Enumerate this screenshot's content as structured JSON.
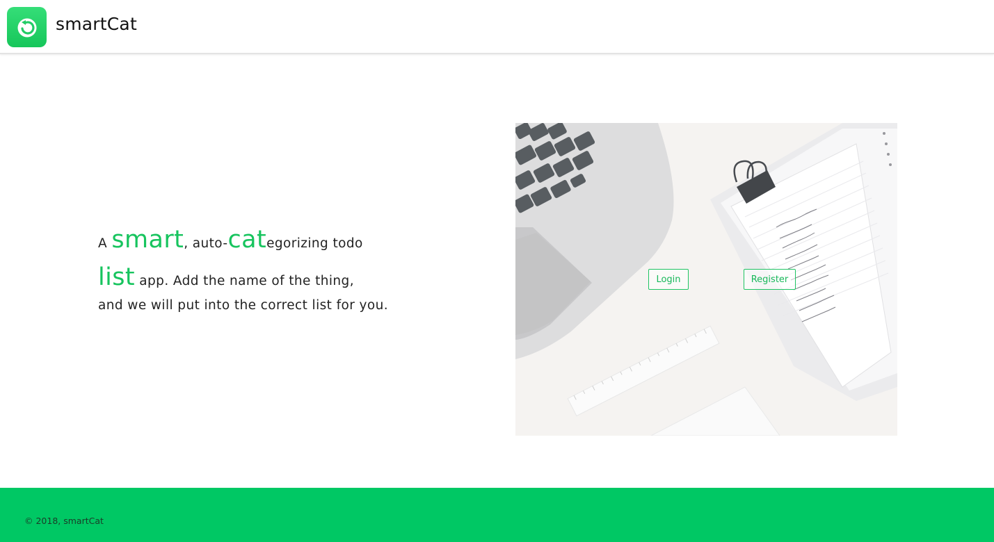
{
  "header": {
    "brand": "smartCat",
    "logo_icon": "refresh-arrow-icon"
  },
  "tagline": {
    "prefix": "A ",
    "smart": "smart",
    "mid1": ", auto-",
    "cat": "cat",
    "mid2": "egorizing todo",
    "list": "list",
    "mid3": " app. Add the name of the thing,",
    "rest": "and we will put into the correct list for you."
  },
  "hero": {
    "login_label": "Login",
    "register_label": "Register",
    "notepad_lines": [
      "RETAIL FOLLOW UP",
      "INDIGO",
      "SAVANNAH BLUE",
      "NEW WEBSITES",
      "POP-UP PITCHES",
      "GET A SCALE",
      "EMAIL 2018 DRAWS",
      "EMAIL KM GROUPS",
      "YOUTUBE CHANNEL",
      "VACCINES",
      "CORPORATE DECK",
      "LIST FOR AUTHOR",
      "APPLICANT APP",
      "FOR YOUR NANNIES",
      "BANKING CAN"
    ]
  },
  "footer": {
    "copyright": "© 2018, smartCat"
  },
  "colors": {
    "accent": "#17c45e",
    "footer_bg": "#00c864"
  }
}
